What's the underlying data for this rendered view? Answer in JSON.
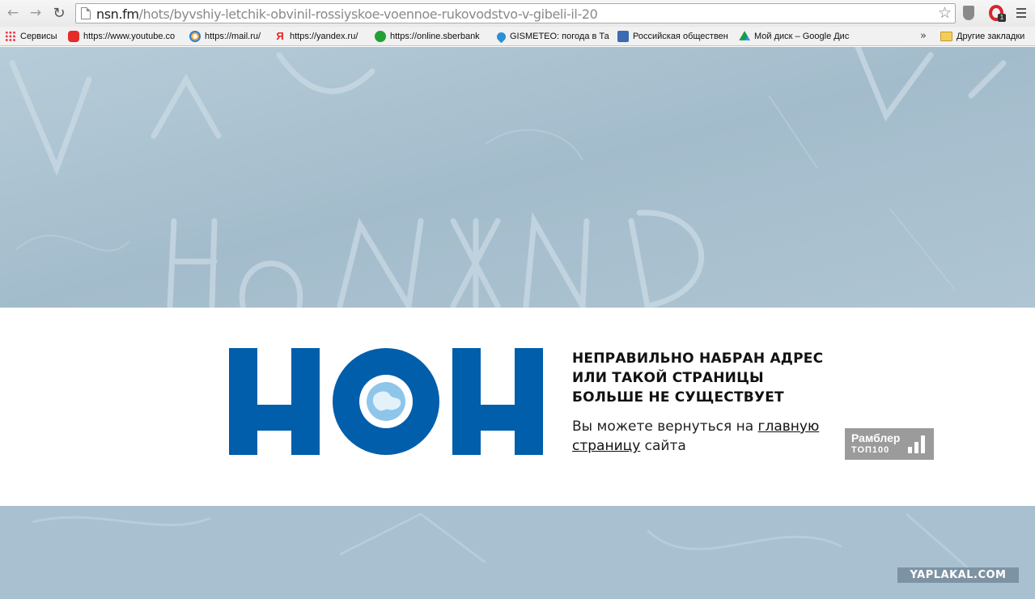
{
  "browser": {
    "url_host": "nsn.fm",
    "url_path": "/hots/byvshiy-letchik-obvinil-rossiyskoe-voennoe-rukovodstvo-v-gibeli-il-20",
    "bookmarks": [
      {
        "label": "Сервисы",
        "icon": "apps-grid-icon"
      },
      {
        "label": "https://www.youtube.co",
        "icon": "youtube-icon"
      },
      {
        "label": "https://mail.ru/",
        "icon": "mail-ru-icon"
      },
      {
        "label": "https://yandex.ru/",
        "icon": "yandex-icon"
      },
      {
        "label": "https://online.sberbank",
        "icon": "sberbank-icon"
      },
      {
        "label": "GISMETEO: погода в Та",
        "icon": "gismeteo-icon"
      },
      {
        "label": "Российская обществен",
        "icon": "russian-public-icon"
      },
      {
        "label": "Мой диск – Google Дис",
        "icon": "google-drive-icon"
      }
    ],
    "more_bookmarks_glyph": "»",
    "other_bookmarks": "Другие закладки",
    "extension_badge": "1"
  },
  "error": {
    "code_logo": "404",
    "title": "НЕПРАВИЛЬНО НАБРАН АДРЕС ИЛИ ТАКОЙ СТРАНИЦЫ БОЛЬШЕ НЕ СУЩЕСТВУЕТ",
    "text_before": "Вы можете вернуться на ",
    "link": "главную страницу",
    "text_after": " сайта"
  },
  "counter": {
    "line1": "Рамблер",
    "line2": "ТОП100"
  },
  "watermark": "YAPLAKAL.COM",
  "colors": {
    "brand_blue": "#005eab",
    "background_tint": "#a9c2d1"
  }
}
